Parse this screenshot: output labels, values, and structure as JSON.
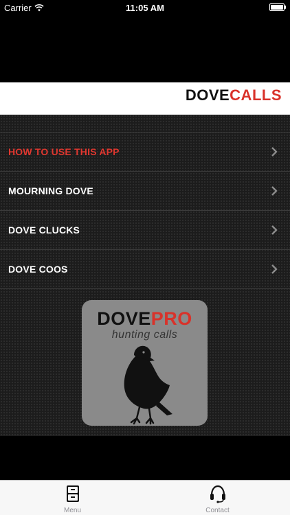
{
  "status_bar": {
    "carrier": "Carrier",
    "time": "11:05 AM"
  },
  "header": {
    "title_part1": "DOVE",
    "title_part2": "CALLS"
  },
  "menu": {
    "items": [
      {
        "label": "HOW TO USE THIS APP",
        "active": true
      },
      {
        "label": "MOURNING DOVE",
        "active": false
      },
      {
        "label": "DOVE CLUCKS",
        "active": false
      },
      {
        "label": "DOVE COOS",
        "active": false
      }
    ]
  },
  "logo": {
    "title_part1": "DOVE",
    "title_part2": "PRO",
    "subtitle": "hunting calls",
    "icon": "dove-silhouette-icon"
  },
  "tab_bar": {
    "tabs": [
      {
        "label": "Menu",
        "icon": "file-cabinet-icon"
      },
      {
        "label": "Contact",
        "icon": "headset-icon"
      }
    ]
  },
  "colors": {
    "accent_red": "#d9322a",
    "background": "#1c1c1c"
  }
}
